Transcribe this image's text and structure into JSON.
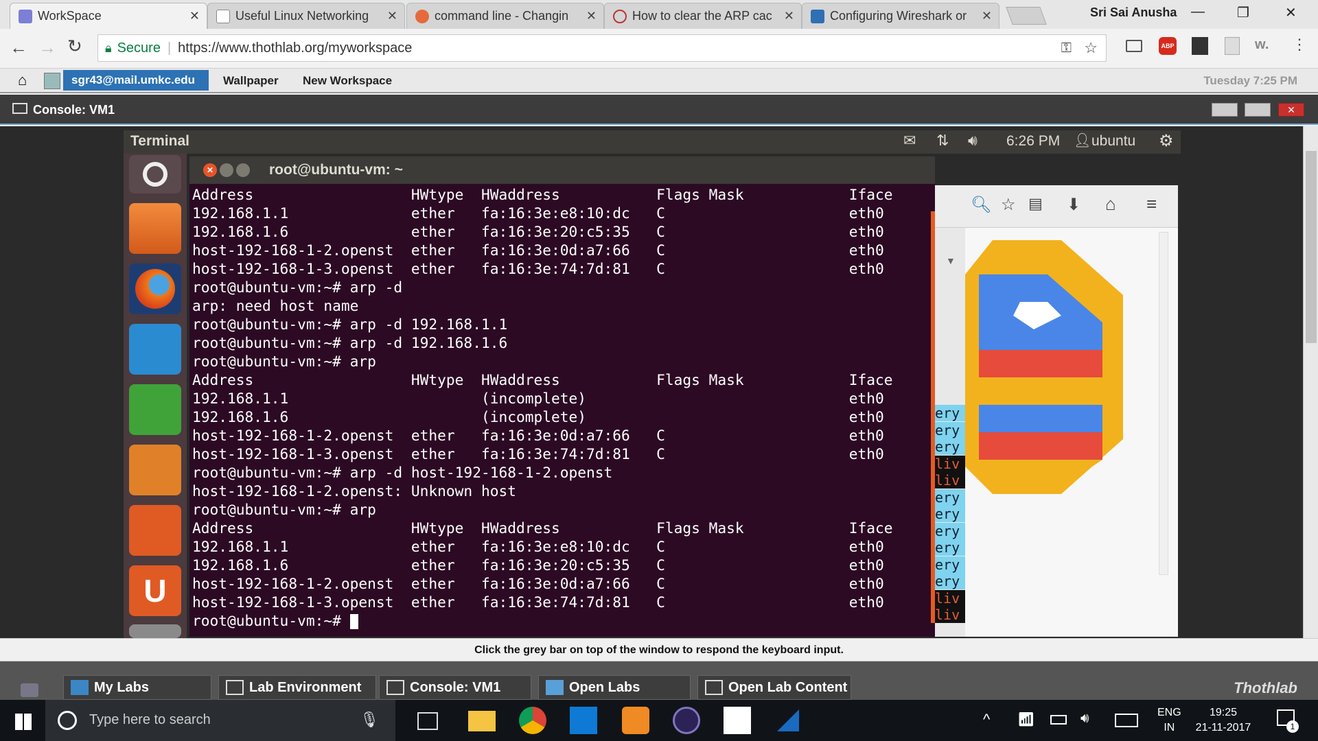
{
  "browser": {
    "tabs": [
      {
        "label": "WorkSpace"
      },
      {
        "label": "Useful Linux Networking"
      },
      {
        "label": "command line - Changin"
      },
      {
        "label": "How to clear the ARP cac"
      },
      {
        "label": "Configuring Wireshark or"
      }
    ],
    "profile_name": "Sri Sai Anusha",
    "address_secure": "Secure",
    "address_url": "https://www.thothlab.org/myworkspace"
  },
  "thoth": {
    "user_email": "sgr43@mail.umkc.edu",
    "wallpaper_label": "Wallpaper",
    "new_workspace_label": "New Workspace",
    "clock": "Tuesday 7:25 PM",
    "console_title": "Console: VM1",
    "footer_note": "Click the grey bar on top of the window to respond the keyboard input.",
    "taskbar": [
      "My Labs",
      "Lab Environment",
      "Console: VM1",
      "Open Labs",
      "Open Lab Content"
    ],
    "brand": "Thothlab"
  },
  "vm": {
    "topbar_title": "Terminal",
    "time": "6:26 PM",
    "user": "ubuntu",
    "terminal_title": "root@ubuntu-vm: ~",
    "terminal_lines": [
      "Address                  HWtype  HWaddress           Flags Mask            Iface",
      "192.168.1.1              ether   fa:16:3e:e8:10:dc   C                     eth0",
      "192.168.1.6              ether   fa:16:3e:20:c5:35   C                     eth0",
      "host-192-168-1-2.openst  ether   fa:16:3e:0d:a7:66   C                     eth0",
      "host-192-168-1-3.openst  ether   fa:16:3e:74:7d:81   C                     eth0",
      "root@ubuntu-vm:~# arp -d",
      "arp: need host name",
      "root@ubuntu-vm:~# arp -d 192.168.1.1",
      "root@ubuntu-vm:~# arp -d 192.168.1.6",
      "root@ubuntu-vm:~# arp",
      "Address                  HWtype  HWaddress           Flags Mask            Iface",
      "192.168.1.1                      (incomplete)                              eth0",
      "192.168.1.6                      (incomplete)                              eth0",
      "host-192-168-1-2.openst  ether   fa:16:3e:0d:a7:66   C                     eth0",
      "host-192-168-1-3.openst  ether   fa:16:3e:74:7d:81   C                     eth0",
      "root@ubuntu-vm:~# arp -d host-192-168-1-2.openst",
      "host-192-168-1-2.openst: Unknown host",
      "root@ubuntu-vm:~# arp",
      "Address                  HWtype  HWaddress           Flags Mask            Iface",
      "192.168.1.1              ether   fa:16:3e:e8:10:dc   C                     eth0",
      "192.168.1.6              ether   fa:16:3e:20:c5:35   C                     eth0",
      "host-192-168-1-2.openst  ether   fa:16:3e:0d:a7:66   C                     eth0",
      "host-192-168-1-3.openst  ether   fa:16:3e:74:7d:81   C                     eth0",
      "root@ubuntu-vm:~# "
    ],
    "side_words": [
      "ery",
      "ery",
      "ery",
      "liv",
      "liv",
      "ery",
      "ery",
      "ery",
      "ery",
      "ery",
      "ery",
      "liv",
      "liv"
    ]
  },
  "windows": {
    "search_placeholder": "Type here to search",
    "lang": "ENG",
    "region": "IN",
    "time": "19:25",
    "date": "21-11-2017",
    "notifications": "1"
  }
}
